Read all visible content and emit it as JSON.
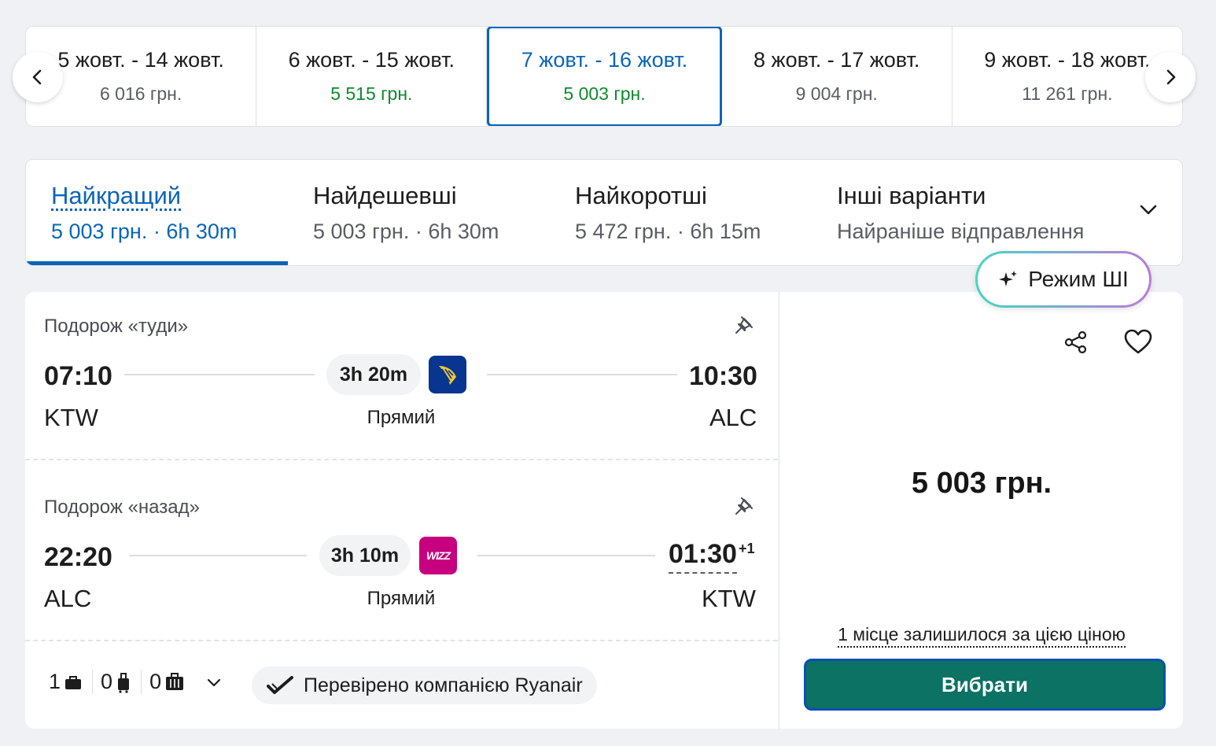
{
  "date_strip": {
    "items": [
      {
        "dates": "5 жовт. - 14 жовт.",
        "price": "6 016 грн."
      },
      {
        "dates": "6 жовт. - 15 жовт.",
        "price": "5 515 грн."
      },
      {
        "dates": "7 жовт. - 16 жовт.",
        "price": "5 003 грн."
      },
      {
        "dates": "8 жовт. - 17 жовт.",
        "price": "9 004 грн."
      },
      {
        "dates": "9 жовт. - 18 жовт.",
        "price": "11 261 грн."
      }
    ],
    "selected_index": 2,
    "prev_icon": "chevron-left-icon",
    "next_icon": "chevron-right-icon"
  },
  "sort_tabs": [
    {
      "title": "Найкращий",
      "sub": "5 003 грн. · 6h 30m"
    },
    {
      "title": "Найдешевші",
      "sub": "5 003 грн. · 6h 30m"
    },
    {
      "title": "Найкоротші",
      "sub": "5 472 грн. · 6h 15m"
    },
    {
      "title": "Інші варіанти",
      "sub": "Найраніше відправлення"
    }
  ],
  "ai_mode": {
    "label": "Режим ШІ",
    "icon": "sparkle-icon"
  },
  "outbound": {
    "title": "Подорож «туди»",
    "depart_time": "07:10",
    "depart_code": "KTW",
    "duration": "3h 20m",
    "stops": "Прямий",
    "arrive_time": "10:30",
    "arrive_code": "ALC",
    "airline_logo": "ryanair-logo"
  },
  "inbound": {
    "title": "Подорож «назад»",
    "depart_time": "22:20",
    "depart_code": "ALC",
    "duration": "3h 10m",
    "stops": "Прямий",
    "arrive_time": "01:30",
    "day_offset": "+1",
    "arrive_code": "KTW",
    "airline_logo": "wizz-logo",
    "wizz_text": "WIZZ"
  },
  "baggage": {
    "personal": "1",
    "carry_on": "0",
    "checked": "0"
  },
  "verified_label": "Перевірено компанією Ryanair",
  "price": "5 003 грн.",
  "seats_left": "1 місце залишилося за цією ціною",
  "select_label": "Вибрати",
  "colors": {
    "brand_blue": "#0a65b8",
    "price_green": "#0f8a2e",
    "button_teal": "#0b7264",
    "ryanair_navy": "#073590",
    "wizz_magenta": "#c6007e"
  }
}
